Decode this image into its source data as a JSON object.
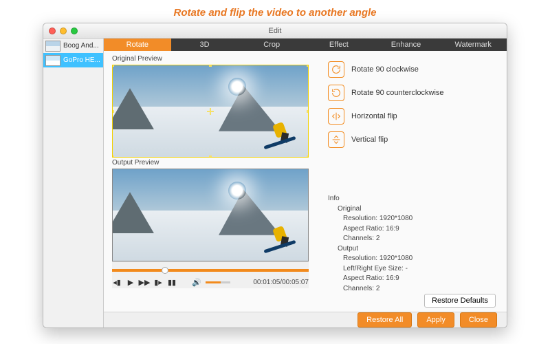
{
  "promo_title": "Rotate and flip the video to another angle",
  "window": {
    "title": "Edit"
  },
  "sidebar": {
    "clips": [
      {
        "name": "Boog And..."
      },
      {
        "name": "GoPro HE..."
      }
    ],
    "selected_index": 1
  },
  "tabs": {
    "items": [
      "Rotate",
      "3D",
      "Crop",
      "Effect",
      "Enhance",
      "Watermark"
    ],
    "active_index": 0
  },
  "previews": {
    "original_label": "Original Preview",
    "output_label": "Output Preview"
  },
  "transport": {
    "elapsed": "00:01:05",
    "duration": "00:05:07",
    "separator": "/",
    "progress_pct": 25,
    "volume_pct": 60,
    "icons": {
      "prev": "prev-icon",
      "play": "play-icon",
      "fwd": "fast-forward-icon",
      "step": "step-icon",
      "stop": "stop-icon",
      "speaker": "speaker-icon"
    }
  },
  "rotate_options": [
    {
      "label": "Rotate 90 clockwise",
      "icon": "rotate-cw-icon"
    },
    {
      "label": "Rotate 90 counterclockwise",
      "icon": "rotate-ccw-icon"
    },
    {
      "label": "Horizontal flip",
      "icon": "flip-horizontal-icon"
    },
    {
      "label": "Vertical flip",
      "icon": "flip-vertical-icon"
    }
  ],
  "info": {
    "heading": "Info",
    "original": {
      "label": "Original",
      "resolution_label": "Resolution:",
      "resolution_value": "1920*1080",
      "aspect_label": "Aspect Ratio:",
      "aspect_value": "16:9",
      "channels_label": "Channels:",
      "channels_value": "2"
    },
    "output": {
      "label": "Output",
      "resolution_label": "Resolution:",
      "resolution_value": "1920*1080",
      "eye_label": "Left/Right Eye Size:",
      "eye_value": "-",
      "aspect_label": "Aspect Ratio:",
      "aspect_value": "16:9",
      "channels_label": "Channels:",
      "channels_value": "2"
    }
  },
  "buttons": {
    "restore_defaults": "Restore Defaults",
    "restore_all": "Restore All",
    "apply": "Apply",
    "close": "Close"
  },
  "colors": {
    "accent": "#f28c28"
  }
}
